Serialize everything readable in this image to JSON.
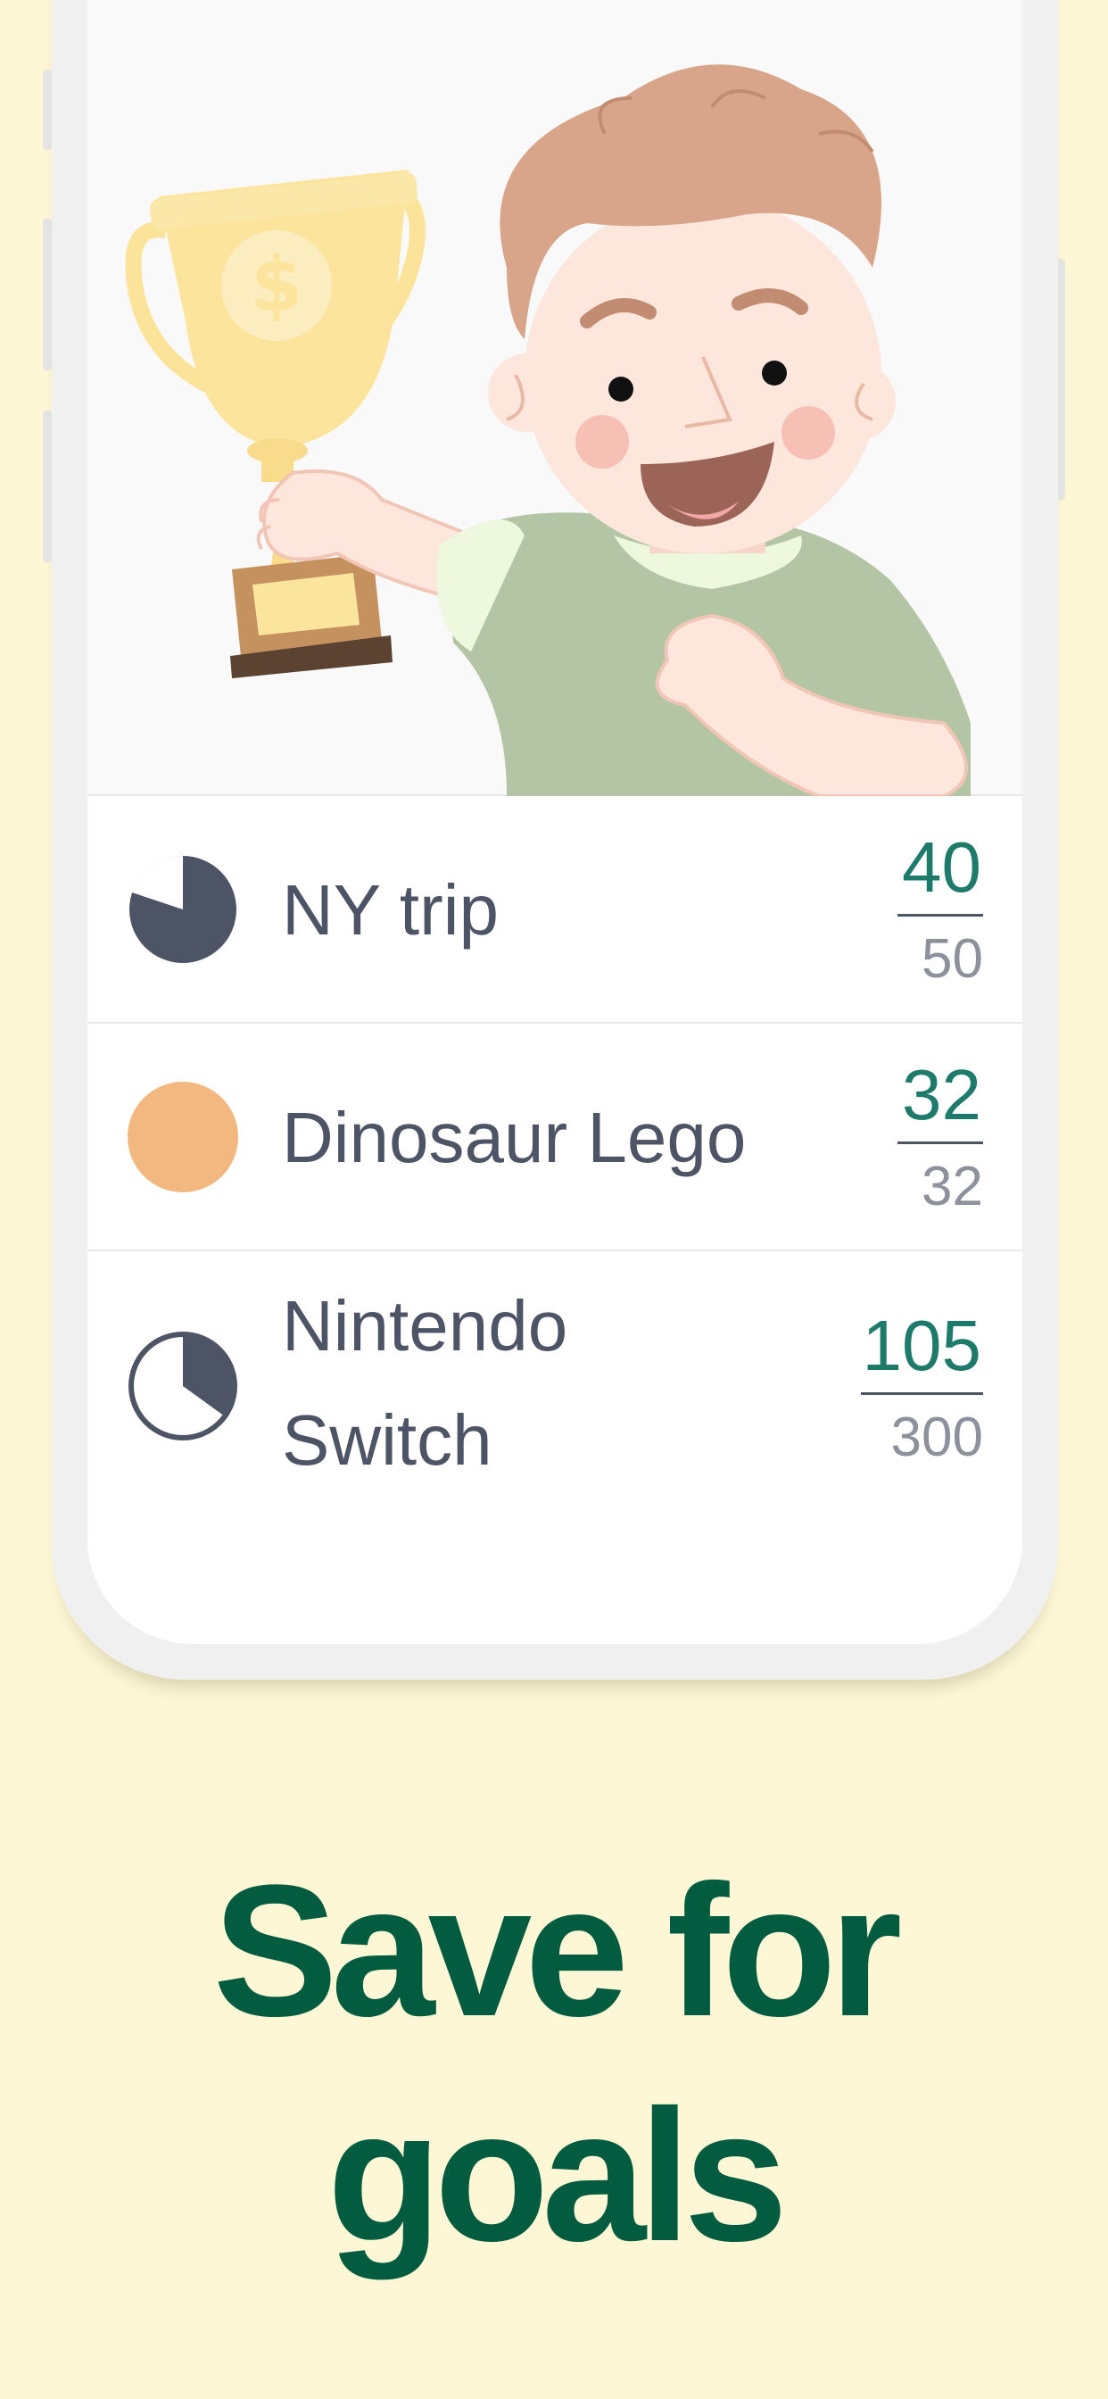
{
  "goals": [
    {
      "name": "NY trip",
      "saved": "40",
      "target": "50",
      "progress": 0.8
    },
    {
      "name": "Dinosaur Lego",
      "saved": "32",
      "target": "32",
      "progress": 1.0
    },
    {
      "name_line1": "Nintendo",
      "name_line2": "Switch",
      "saved": "105",
      "target": "300",
      "progress": 0.35
    }
  ],
  "headline": {
    "line1": "Save for",
    "line2": "goals"
  },
  "colors": {
    "background": "#fdf7d6",
    "headline": "#035c3f",
    "saved_amount": "#1e7a6a",
    "goal_text": "#4d5466",
    "target_amount": "#8c919b",
    "progress_dark": "#4d5466",
    "progress_complete": "#f2b880"
  },
  "illustration": "boy-holding-trophy"
}
